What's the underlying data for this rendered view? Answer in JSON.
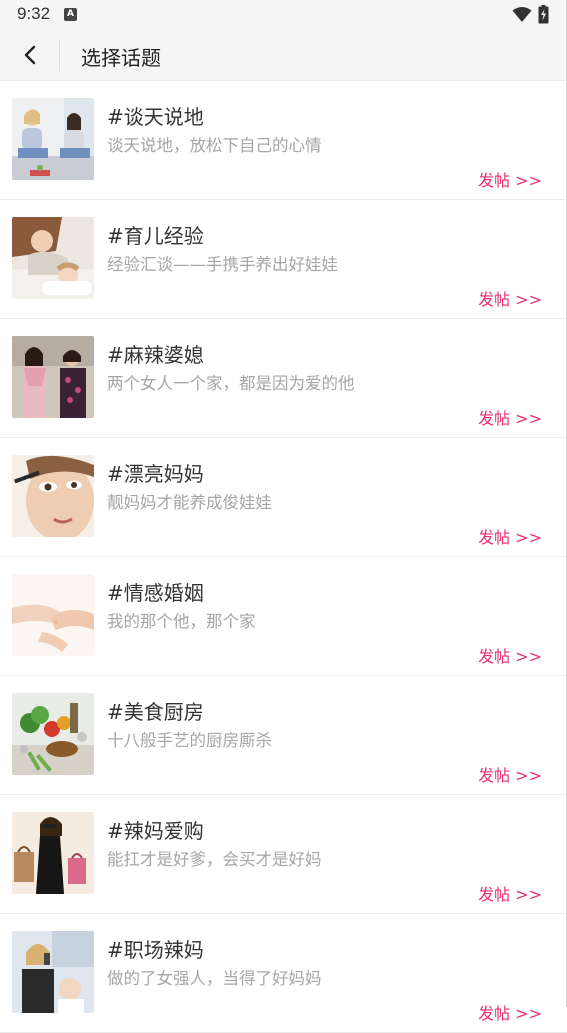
{
  "status_bar": {
    "time": "9:32",
    "notification_badge": "A",
    "icons": [
      "wifi-icon",
      "battery-charging-icon"
    ]
  },
  "header": {
    "back_icon": "chevron-left-icon",
    "title": "选择话题"
  },
  "topics": [
    {
      "title": "#谈天说地",
      "desc": "谈天说地，放松下自己的心情",
      "action": "发帖 >>",
      "thumb": "two-women-chatting"
    },
    {
      "title": "#育儿经验",
      "desc": "经验汇谈——手携手养出好娃娃",
      "action": "发帖 >>",
      "thumb": "mother-and-sleeping-child"
    },
    {
      "title": "#麻辣婆媳",
      "desc": "两个女人一个家，都是因为爱的他",
      "action": "发帖 >>",
      "thumb": "mother-in-law-and-daughter-in-law"
    },
    {
      "title": "#漂亮妈妈",
      "desc": "靓妈妈才能养成俊娃娃",
      "action": "发帖 >>",
      "thumb": "woman-applying-mascara"
    },
    {
      "title": "#情感婚姻",
      "desc": "我的那个他，那个家",
      "action": "发帖 >>",
      "thumb": "holding-hands"
    },
    {
      "title": "#美食厨房",
      "desc": "十八般手艺的厨房厮杀",
      "action": "发帖 >>",
      "thumb": "vegetables-and-food"
    },
    {
      "title": "#辣妈爱购",
      "desc": "能扛才是好爹，会买才是好妈",
      "action": "发帖 >>",
      "thumb": "woman-with-shopping-bags"
    },
    {
      "title": "#职场辣妈",
      "desc": "做的了女强人，当得了好妈妈",
      "action": "发帖 >>",
      "thumb": "working-mother-with-baby"
    }
  ],
  "colors": {
    "accent": "#e8306a",
    "title_text": "#333333",
    "desc_text": "#a6a6a6",
    "header_bg": "#f5f5f5"
  }
}
